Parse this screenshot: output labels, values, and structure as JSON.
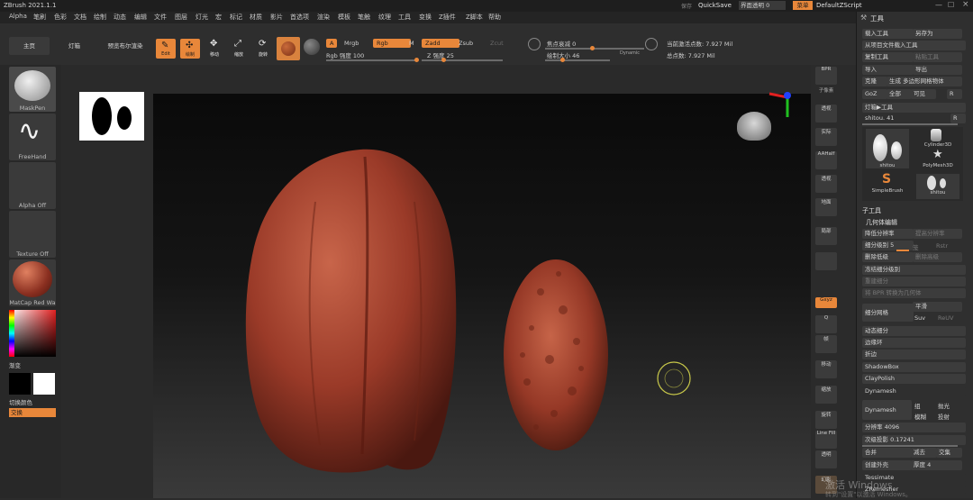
{
  "title": {
    "app": "ZBrush 2021.1.1",
    "quicksave": "QuickSave",
    "trans_label": "界面透明 0",
    "menus_btn": "菜单",
    "script": "DefaultZScript"
  },
  "menu": [
    "Alpha",
    "笔刷",
    "色彩",
    "文档",
    "绘制",
    "动态",
    "编辑",
    "文件",
    "图层",
    "灯光",
    "宏",
    "标记",
    "材质",
    "影片",
    "首选项",
    "渲染",
    "模板",
    "笔触",
    "纹理",
    "工具",
    "变换",
    "Z插件",
    "Z脚本",
    "帮助"
  ],
  "toolbar": {
    "home": "主页",
    "lightbox": "灯箱",
    "preview_render": "预览布尔渲染",
    "edit": "Edit",
    "draw": "绘制",
    "move": "移动",
    "scale": "缩放",
    "rotate": "旋转",
    "a": "A",
    "mrgb": "Mrgb",
    "rgb": "Rgb",
    "m": "M",
    "zadd": "Zadd",
    "zsub": "Zsub",
    "zcut": "Zcut",
    "rgb_intensity": "Rgb 强度 100",
    "z_intensity": "Z 强度 25",
    "focal_shift": "焦点衰减 0",
    "draw_size": "绘制大小 46",
    "dynamic": "Dynamic",
    "active_points": "当前激活点数: 7.927 Mil",
    "total_points": "总点数: 7.927 Mil"
  },
  "left": {
    "maskpen": "MaskPen",
    "freehand": "FreeHand",
    "alpha": "Alpha Off",
    "texture": "Texture Off",
    "matcap": "MatCap Red Wa",
    "gradient": "渐变",
    "switch_color": "切换颜色",
    "swap": "交换"
  },
  "right_col": [
    "BPR",
    "子像素",
    "透视",
    "实际",
    "AAHalf",
    "透视",
    "地面",
    "局部",
    "Gxyz",
    "",
    "帧",
    "移动",
    "缩放",
    "旋转",
    "Line Fill",
    "PolyF",
    "透明",
    "幻影"
  ],
  "panel": {
    "header": "工具",
    "load": "载入工具",
    "save_as": "另存为",
    "load_from_project": "从项目文件载入工具",
    "copy": "复制工具",
    "paste": "粘贴工具",
    "import": "导入",
    "export": "导出",
    "clone": "克隆",
    "make_polymesh": "生成 多边形网格物体",
    "goz": "GoZ",
    "all": "全部",
    "visible": "可见",
    "r": "R",
    "lightbox_tools": "灯箱▶工具",
    "current_tool": "shitou. 41",
    "thumbs": [
      "shitou",
      "Cylinder3D",
      "PolyMesh3D",
      "SimpleBrush",
      "shitou"
    ],
    "subtool": "子工具",
    "geometry": "几何体编辑",
    "lower_res": "降低分辨率",
    "higher_res": "提高分辨率",
    "sdiv": "细分级别 5",
    "del_lower": "删除低级",
    "del_higher": "删除高级",
    "freeze": "冻结细分级别",
    "reconstruct": "重建细分",
    "convert_bpr": "将 BPR 转换为几何体",
    "divide": "细分网格",
    "smooth": "平滑",
    "suv": "Suv",
    "reuv": "ReUV",
    "dynamic_sub": "动态细分",
    "edge_loop": "边缘环",
    "crease": "折边",
    "shadowbox": "ShadowBox",
    "claypolish": "ClayPolish",
    "dynamesh": "Dynamesh",
    "dynamesh_btn": "Dynamesh",
    "group": "组",
    "polish": "抛光",
    "blur": "模糊",
    "project": "投射",
    "resolution": "分辨率 4096",
    "sub_proj": "次级投影 0.17241",
    "add": "合并",
    "sub": "减去",
    "and": "交集",
    "create_shell": "创建外壳",
    "thickness": "厚度 4",
    "tessimate": "Tessimate",
    "zremesher": "ZRemesher"
  },
  "watermark": {
    "line1": "激活 Windows",
    "line2": "转到\"设置\"以激活 Windows。"
  }
}
